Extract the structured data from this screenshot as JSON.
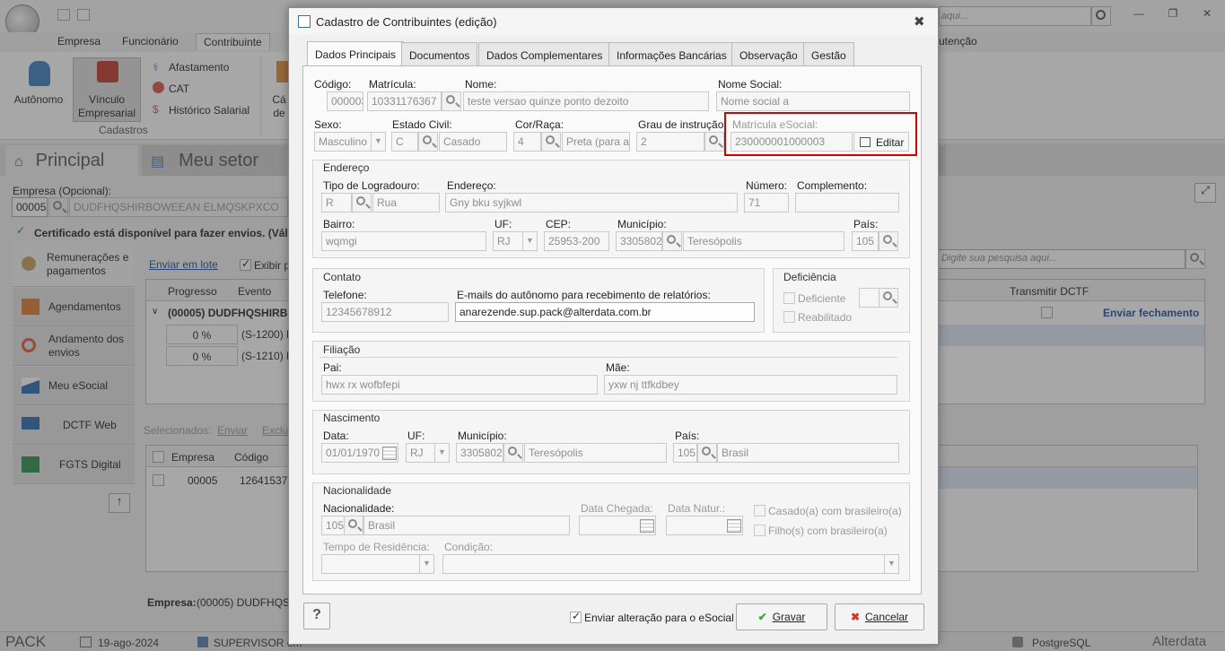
{
  "app": {
    "search_placeholder": "aqui...",
    "ribbon_tabs": [
      "Empresa",
      "Funcionário",
      "Contribuinte",
      "utenção"
    ],
    "ribbon_buttons": {
      "autonomo": "Autônomo",
      "vinculo": "Vínculo Empresarial",
      "afastamento": "Afastamento",
      "cat": "CAT",
      "historico": "Histórico Salarial",
      "cadastros": "Cadastros",
      "cut_label": "Cá de"
    },
    "module_tabs": [
      "Principal",
      "Meu setor"
    ],
    "empresa_label": "Empresa (Opcional):",
    "empresa_code": "00005",
    "empresa_name": "DUDFHQSHIRBOWEEAN ELMQSKPXCO",
    "certificado_text": "Certificado está disponível para fazer envios. (Válid",
    "side_items": [
      "Remunerações e pagamentos",
      "Agendamentos",
      "Andamento dos envios",
      "Meu eSocial",
      "DCTF Web",
      "FGTS Digital"
    ],
    "enviar_em_lote": "Enviar em lote",
    "exibir_p": "Exibir p",
    "grid_headers": [
      "Progresso",
      "Evento",
      "Transmitir DCTF"
    ],
    "grid_group": "(00005) DUDFHQSHIRB",
    "grid_rows": [
      {
        "progress": "0 %",
        "event": "(S-1200) R"
      },
      {
        "progress": "0 %",
        "event": "(S-1210) P"
      }
    ],
    "enviar_fechamento": "Enviar fechamento",
    "search2_placeholder": "Digite sua pesquisa aqui...",
    "selecionados": "Selecionados:",
    "sel_enviar": "Enviar",
    "sel_excluir": "Exclu",
    "grid2_headers": [
      "Empresa",
      "Código"
    ],
    "grid2_row": {
      "empresa": "00005",
      "codigo": "126415373"
    },
    "empresa_footer_label": "Empresa:",
    "empresa_footer_value": "(00005) DUDFHQSH",
    "statusbar": {
      "pack": "PACK",
      "date": "19-ago-2024",
      "user": "SUPERVISOR em",
      "db": "PostgreSQL",
      "brand": "Alterdata"
    }
  },
  "dialog": {
    "title": "Cadastro de Contribuintes (edição)",
    "tabs": [
      "Dados Principais",
      "Documentos",
      "Dados Complementares",
      "Informações Bancárias",
      "Observação",
      "Gestão"
    ],
    "fields": {
      "codigo_label": "Código:",
      "codigo": "000003",
      "matricula_label": "Matrícula:",
      "matricula": "10331176367",
      "nome_label": "Nome:",
      "nome": "teste versao quinze ponto dezoito",
      "nome_social_label": "Nome Social:",
      "nome_social": "Nome social a",
      "sexo_label": "Sexo:",
      "sexo": "Masculino",
      "estado_civil_label": "Estado Civil:",
      "estado_civil_code": "C",
      "estado_civil": "Casado",
      "cor_label": "Cor/Raça:",
      "cor_code": "4",
      "cor": "Preta (para a p",
      "grau_label": "Grau de instrução:",
      "grau_code": "2",
      "matricula_esocial_label": "Matrícula eSocial:",
      "matricula_esocial": "230000001000003",
      "editar": "Editar"
    },
    "endereco": {
      "title": "Endereço",
      "tipo_label": "Tipo de Logradouro:",
      "tipo_code": "R",
      "tipo": "Rua",
      "endereco_label": "Endereço:",
      "endereco": "Gny bku syjkwl",
      "numero_label": "Número:",
      "numero": "71",
      "complemento_label": "Complemento:",
      "complemento": "",
      "bairro_label": "Bairro:",
      "bairro": "wqmgi",
      "uf_label": "UF:",
      "uf": "RJ",
      "cep_label": "CEP:",
      "cep": "25953-200",
      "municipio_label": "Município:",
      "municipio_code": "3305802",
      "municipio": "Teresópolis",
      "pais_label": "País:",
      "pais_code": "105"
    },
    "contato": {
      "title": "Contato",
      "telefone_label": "Telefone:",
      "telefone": "12345678912",
      "emails_label": "E-mails do autônomo para recebimento de relatórios:",
      "emails": "anarezende.sup.pack@alterdata.com.br"
    },
    "deficiencia": {
      "title": "Deficiência",
      "deficiente": "Deficiente",
      "reabilitado": "Reabilitado"
    },
    "filiacao": {
      "title": "Filiação",
      "pai_label": "Pai:",
      "pai": "hwx rx wofbfepi",
      "mae_label": "Mãe:",
      "mae": "yxw nj ttfkdbey"
    },
    "nascimento": {
      "title": "Nascimento",
      "data_label": "Data:",
      "data": "01/01/1970",
      "uf_label": "UF:",
      "uf": "RJ",
      "municipio_label": "Município:",
      "municipio_code": "3305802",
      "municipio": "Teresópolis",
      "pais_label": "País:",
      "pais_code": "105",
      "pais": "Brasil"
    },
    "nacionalidade": {
      "title": "Nacionalidade",
      "nac_label": "Nacionalidade:",
      "nac_code": "105",
      "nac": "Brasil",
      "data_chegada_label": "Data Chegada:",
      "data_natur_label": "Data Natur.:",
      "casado_label": "Casado(a) com brasileiro(a)",
      "filho_label": "Filho(s) com brasileiro(a)",
      "tempo_label": "Tempo de Residência:",
      "condicao_label": "Condição:"
    },
    "footer": {
      "help": "?",
      "enviar_alteracao": "Enviar alteração para o eSocial",
      "gravar": "Gravar",
      "cancelar": "Cancelar"
    }
  }
}
